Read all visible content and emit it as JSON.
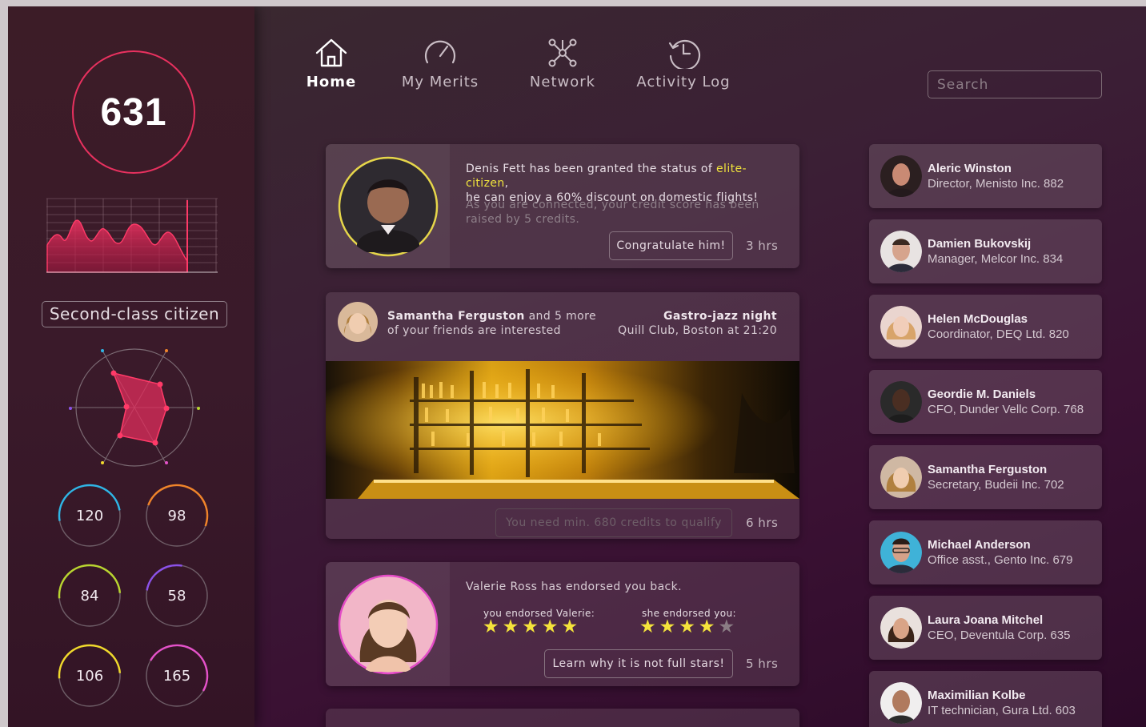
{
  "score": "631",
  "status": "Second-class citizen",
  "metrics": [
    "120",
    "98",
    "84",
    "58",
    "106",
    "165"
  ],
  "nav": {
    "home": "Home",
    "merits": "My Merits",
    "network": "Network",
    "activity": "Activity Log"
  },
  "search": {
    "placeholder": "Search"
  },
  "feed": {
    "post1": {
      "text_before": "Denis Fett has been granted the status of ",
      "highlight": "elite-citizen",
      "text_after": ",",
      "line2": "he can enjoy a 60% discount on domestic flights!",
      "secondary_line1": "As you are connected, your credit score has been",
      "secondary_line2": "raised by 5 credits.",
      "button": "Congratulate him!",
      "time": "3 hrs"
    },
    "post2": {
      "friend_name": "Samantha Ferguston",
      "friend_more": " and 5 more",
      "friend_line2": "of your friends are interested",
      "event_title": "Gastro-jazz night",
      "event_place": "Quill Club, Boston at 21:20",
      "button": "You need min. 680 credits to qualify",
      "time": "6 hrs"
    },
    "post3": {
      "text": "Valerie Ross has endorsed you back.",
      "you_label": "you endorsed Valerie:",
      "she_label": "she endorsed you:",
      "you_stars": 5,
      "she_stars": 4,
      "button": "Learn why it is not full stars!",
      "time": "5 hrs"
    }
  },
  "contacts": [
    {
      "name": "Aleric Winston",
      "role": "Director, Menisto Inc. 882"
    },
    {
      "name": "Damien Bukovskij",
      "role": "Manager, Melcor Inc. 834"
    },
    {
      "name": "Helen McDouglas",
      "role": "Coordinator, DEQ Ltd. 820"
    },
    {
      "name": "Geordie M. Daniels",
      "role": "CFO, Dunder Vellc Corp. 768"
    },
    {
      "name": "Samantha Ferguston",
      "role": "Secretary, Budeii Inc. 702"
    },
    {
      "name": "Michael Anderson",
      "role": "Office asst., Gento Inc. 679"
    },
    {
      "name": "Laura Joana Mitchel",
      "role": "CEO, Deventula Corp. 635"
    },
    {
      "name": "Maximilian Kolbe",
      "role": "IT technician, Gura Ltd. 603"
    }
  ],
  "colors": {
    "accent": "#e8315f",
    "highlight": "#f0e33c",
    "ring_cyan": "#2fb6e6",
    "ring_orange": "#f0842a",
    "ring_yellowgreen": "#b9d530",
    "ring_purple": "#8b52e8",
    "ring_yellow": "#f0d92c",
    "ring_pink": "#e452c9"
  }
}
